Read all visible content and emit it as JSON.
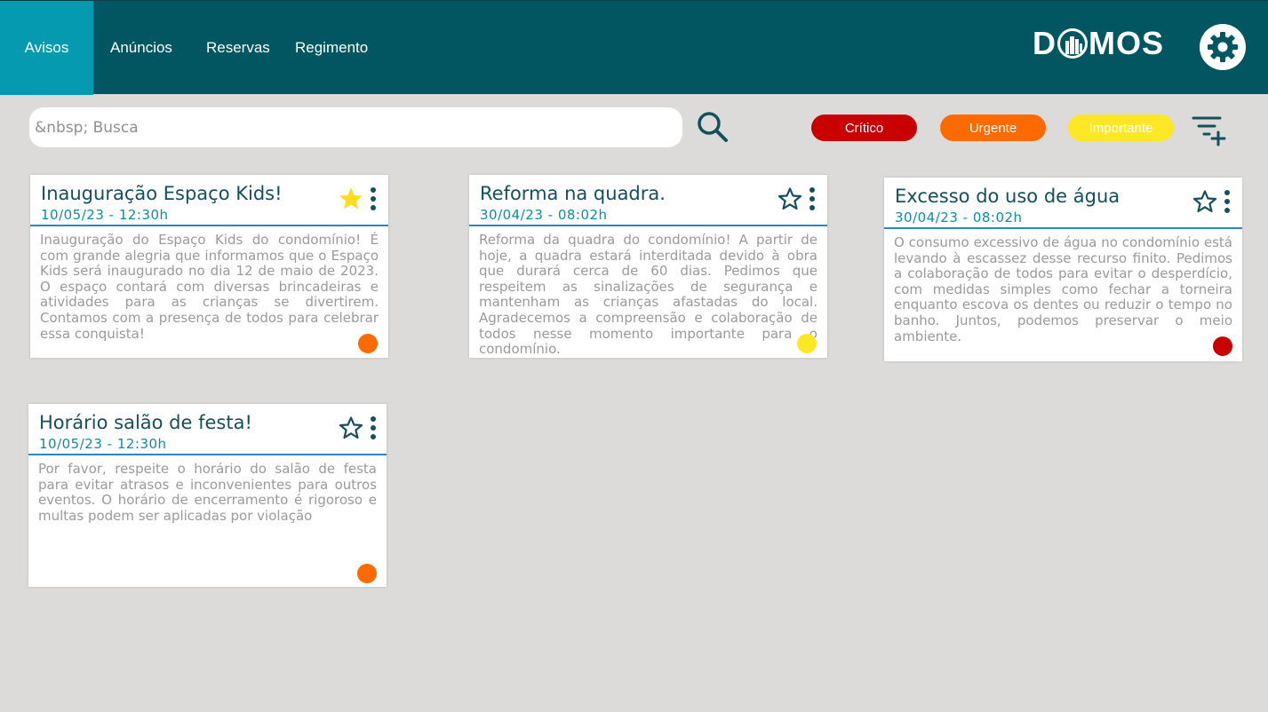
{
  "nav": {
    "items": [
      {
        "label": "Avisos",
        "active": true
      },
      {
        "label": "Anúncios",
        "active": false
      },
      {
        "label": "Reservas",
        "active": false
      },
      {
        "label": "Regimento",
        "active": false
      }
    ]
  },
  "brand": {
    "logo_text_left": "D",
    "logo_text_right": "MOS"
  },
  "search": {
    "placeholder": "&nbsp; Busca"
  },
  "filters": {
    "critico": "Crítico",
    "urgente": "Urgente",
    "importante": "Importante"
  },
  "colors": {
    "header": "#015662",
    "active_tab": "#069ab1",
    "critico": "#c90000",
    "urgente": "#ff6a00",
    "importante": "#fde726",
    "star_filled": "#fddc1a"
  },
  "notices": [
    {
      "title": "Inauguração Espaço Kids!",
      "date": "10/05/23 - 12:30h",
      "body": "Inauguração do Espaço Kids do condomínio! É com grande alegria que informamos que o Espaço Kids será inaugurado no dia 12 de maio de 2023. O espaço contará com diversas brincadeiras e atividades para as crianças se divertirem. Contamos com a presença de todos para celebrar essa conquista!",
      "favorite": true,
      "priority": "urgente",
      "priority_icon": "orange-circle"
    },
    {
      "title": "Reforma na quadra.",
      "date": "30/04/23 - 08:02h",
      "body": "Reforma da quadra do condomínio! A partir de hoje, a quadra estará interditada devido à obra que durará cerca de 60 dias. Pedimos que respeitem as sinalizações de segurança e mantenham as crianças afastadas do local. Agradecemos a compreensão e colaboração de todos nesse momento importante para o condomínio.",
      "favorite": false,
      "priority": "importante",
      "priority_icon": "yellow-circle"
    },
    {
      "title": "Excesso do uso de água",
      "date": "30/04/23 - 08:02h",
      "body": "O consumo excessivo de água no condomínio está levando à escassez desse recurso finito. Pedimos a colaboração de todos para evitar o desperdício, com medidas simples como fechar a torneira enquanto escova os dentes ou reduzir o tempo no banho. Juntos, podemos preservar o meio ambiente.",
      "favorite": false,
      "priority": "critico",
      "priority_icon": "red-circle"
    },
    {
      "title": "Horário salão de festa!",
      "date": "10/05/23 - 12:30h",
      "body": "Por favor, respeite o horário do salão de festa para evitar atrasos e inconvenientes para outros eventos. O horário de encerramento é rigoroso e multas podem ser aplicadas por violação",
      "favorite": false,
      "priority": "urgente",
      "priority_icon": "orange-circle"
    }
  ]
}
